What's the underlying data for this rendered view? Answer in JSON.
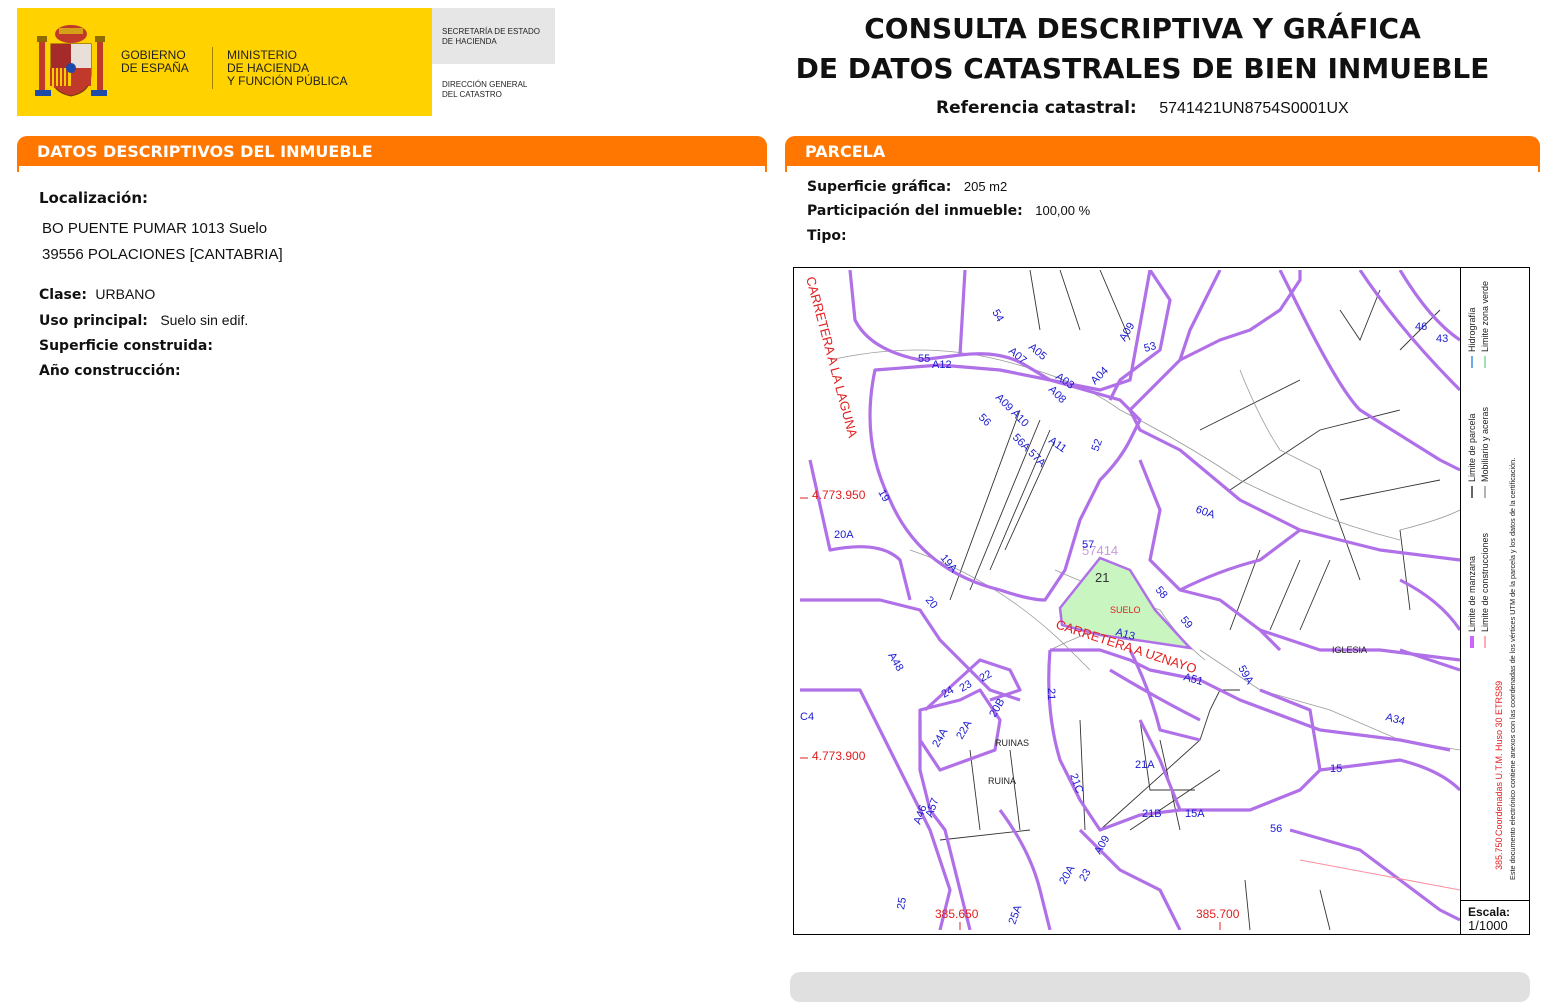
{
  "header": {
    "gov_line1": "GOBIERNO",
    "gov_line2": "DE ESPAÑA",
    "min_line1": "MINISTERIO",
    "min_line2": "DE HACIENDA",
    "min_line3": "Y FUNCIÓN PÚBLICA",
    "sec_line1": "SECRETARÍA DE ESTADO",
    "sec_line2": "DE HACIENDA",
    "dir_line1": "DIRECCIÓN GENERAL",
    "dir_line2": "DEL CATASTRO",
    "title_line1": "CONSULTA DESCRIPTIVA Y GRÁFICA",
    "title_line2": "DE DATOS CATASTRALES DE BIEN INMUEBLE",
    "ref_label": "Referencia catastral:",
    "ref_value": "5741421UN8754S0001UX"
  },
  "left": {
    "bar_prefix": "DATOS DESCRIPTIVOS DEL ",
    "bar_emph": "INMUEBLE",
    "localizacion_label": "Localización:",
    "address_line1": "BO PUENTE PUMAR 1013 Suelo",
    "address_line2": "39556 POLACIONES [CANTABRIA]",
    "clase_label": "Clase:",
    "clase_value": "URBANO",
    "uso_label": "Uso principal:",
    "uso_value": "Suelo sin edif.",
    "superficie_label": "Superficie construida:",
    "anio_label": "Año construcción:"
  },
  "right": {
    "bar_title": "PARCELA",
    "superficie_label": "Superficie gráfica:",
    "superficie_value": "205 m2",
    "participacion_label": "Participación del inmueble:",
    "participacion_value": "100,00 %",
    "tipo_label": "Tipo:"
  },
  "map": {
    "road1": "CARRETERA A LA LAGUNA",
    "road2": "CARRETERA A UZNAYO",
    "coord_y1": "4.773.950",
    "coord_y2": "4.773.900",
    "coord_x1": "385.650",
    "coord_x2": "385.700",
    "coord_x_legend": "385.750",
    "parcel_ref": "57414",
    "parcel_num": "21",
    "suelo": "SUELO",
    "iglesia": "IGLESIA",
    "ruinas1": "RUINAS",
    "ruinas2": "RUINA",
    "legend_limite_manzana": "Limite de manzana",
    "legend_limite_parcela": "Limite de parcela",
    "legend_hidrografia": "Hidrografía",
    "legend_limite_construcciones": "Limite de construcciones",
    "legend_mobiliario": "Mobiliario y aceras",
    "legend_zona_verde": "Limite zona verde",
    "legend_coords": "Coordenadas U.T.M. Huso 30 ETRS89",
    "legend_note": "Este documento electrónico contiene anexos con las coordenadas de los vértices UTM de la parcela y los datos de la certificación.",
    "scale_label": "Escala:",
    "scale_value": "1/1000",
    "labels": [
      "54",
      "A09",
      "53",
      "A07",
      "A05",
      "A03",
      "55",
      "A12",
      "A04",
      "A08",
      "A09 A10",
      "56",
      "56A 57A",
      "A11",
      "52",
      "19",
      "60A",
      "20A",
      "19A",
      "57",
      "58",
      "59",
      "20",
      "A13",
      "A48",
      "59A",
      "24",
      "23",
      "22",
      "A51",
      "21",
      "A34",
      "20B",
      "22A",
      "24A",
      "21C",
      "21A",
      "15",
      "A46",
      "A57",
      "21B",
      "15A",
      "56",
      "A09",
      "20A",
      "23",
      "25",
      "25A",
      "46",
      "43",
      "C4"
    ]
  },
  "colors": {
    "orange": "#ff7700",
    "yellow": "#ffd200",
    "manzana": "#b070e8",
    "parcel_fill": "#c8f5c0",
    "label_blue": "#1a1ad0",
    "red": "#e02020"
  }
}
